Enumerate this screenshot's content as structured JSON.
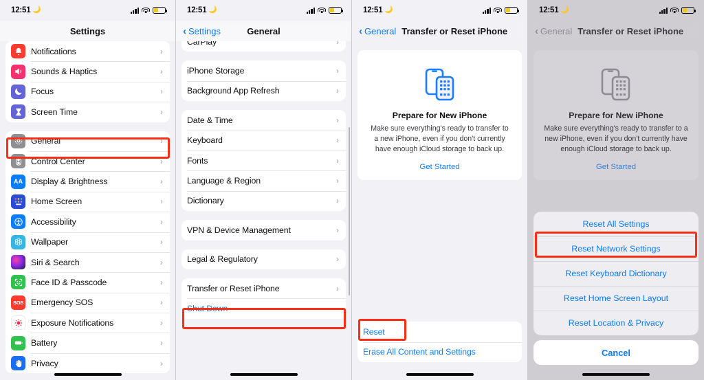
{
  "statusbar": {
    "time": "12:51",
    "moon_icon": "crescent-moon-icon",
    "signal_icon": "cellular-signal-icon",
    "wifi_icon": "wifi-icon",
    "battery_icon": "battery-low-power-icon"
  },
  "screen1": {
    "title": "Settings",
    "group1": [
      {
        "label": "Notifications",
        "icon": "notifications-bell-icon"
      },
      {
        "label": "Sounds & Haptics",
        "icon": "speaker-icon"
      },
      {
        "label": "Focus",
        "icon": "crescent-moon-icon"
      },
      {
        "label": "Screen Time",
        "icon": "hourglass-icon"
      }
    ],
    "group2": [
      {
        "label": "General",
        "icon": "gear-icon"
      },
      {
        "label": "Control Center",
        "icon": "sliders-icon"
      },
      {
        "label": "Display & Brightness",
        "icon": "aa-text-icon"
      },
      {
        "label": "Home Screen",
        "icon": "app-grid-icon"
      },
      {
        "label": "Accessibility",
        "icon": "accessibility-person-icon"
      },
      {
        "label": "Wallpaper",
        "icon": "flower-icon"
      },
      {
        "label": "Siri & Search",
        "icon": "siri-orb-icon"
      },
      {
        "label": "Face ID & Passcode",
        "icon": "face-id-icon"
      },
      {
        "label": "Emergency SOS",
        "icon": "sos-icon"
      },
      {
        "label": "Exposure Notifications",
        "icon": "exposure-dot-icon"
      },
      {
        "label": "Battery",
        "icon": "battery-icon"
      },
      {
        "label": "Privacy",
        "icon": "hand-icon"
      }
    ],
    "chevron": "›"
  },
  "screen2": {
    "back_label": "Settings",
    "title": "General",
    "back_chevron": "‹",
    "chevron": "›",
    "group0": [
      {
        "label": "CarPlay"
      }
    ],
    "group1": [
      {
        "label": "iPhone Storage"
      },
      {
        "label": "Background App Refresh"
      }
    ],
    "group2": [
      {
        "label": "Date & Time"
      },
      {
        "label": "Keyboard"
      },
      {
        "label": "Fonts"
      },
      {
        "label": "Language & Region"
      },
      {
        "label": "Dictionary"
      }
    ],
    "group3": [
      {
        "label": "VPN & Device Management"
      }
    ],
    "group4": [
      {
        "label": "Legal & Regulatory"
      }
    ],
    "group5": [
      {
        "label": "Transfer or Reset iPhone"
      },
      {
        "label": "Shut Down",
        "link": true
      }
    ]
  },
  "screen3": {
    "back_label": "General",
    "title": "Transfer or Reset iPhone",
    "back_chevron": "‹",
    "card": {
      "art_icon": "two-phones-transfer-icon",
      "title": "Prepare for New iPhone",
      "subtitle": "Make sure everything's ready to transfer to a new iPhone, even if you don't currently have enough iCloud storage to back up.",
      "cta": "Get Started"
    },
    "bottom_group": [
      {
        "label": "Reset"
      },
      {
        "label": "Erase All Content and Settings"
      }
    ]
  },
  "screen4": {
    "back_label": "General",
    "title": "Transfer or Reset iPhone",
    "back_chevron": "‹",
    "card": {
      "art_icon": "two-phones-transfer-icon",
      "title": "Prepare for New iPhone",
      "subtitle": "Make sure everything's ready to transfer to a new iPhone, even if you don't currently have enough iCloud storage to back up.",
      "cta": "Get Started"
    },
    "sheet": {
      "items": [
        {
          "label": "Reset All Settings"
        },
        {
          "label": "Reset Network Settings"
        },
        {
          "label": "Reset Keyboard Dictionary"
        },
        {
          "label": "Reset Home Screen Layout"
        },
        {
          "label": "Reset Location & Privacy"
        }
      ],
      "cancel": "Cancel"
    }
  },
  "highlights": {
    "color": "#fa2d15",
    "targets": [
      "General",
      "Transfer or Reset iPhone",
      "Reset",
      "Reset Network Settings"
    ]
  }
}
